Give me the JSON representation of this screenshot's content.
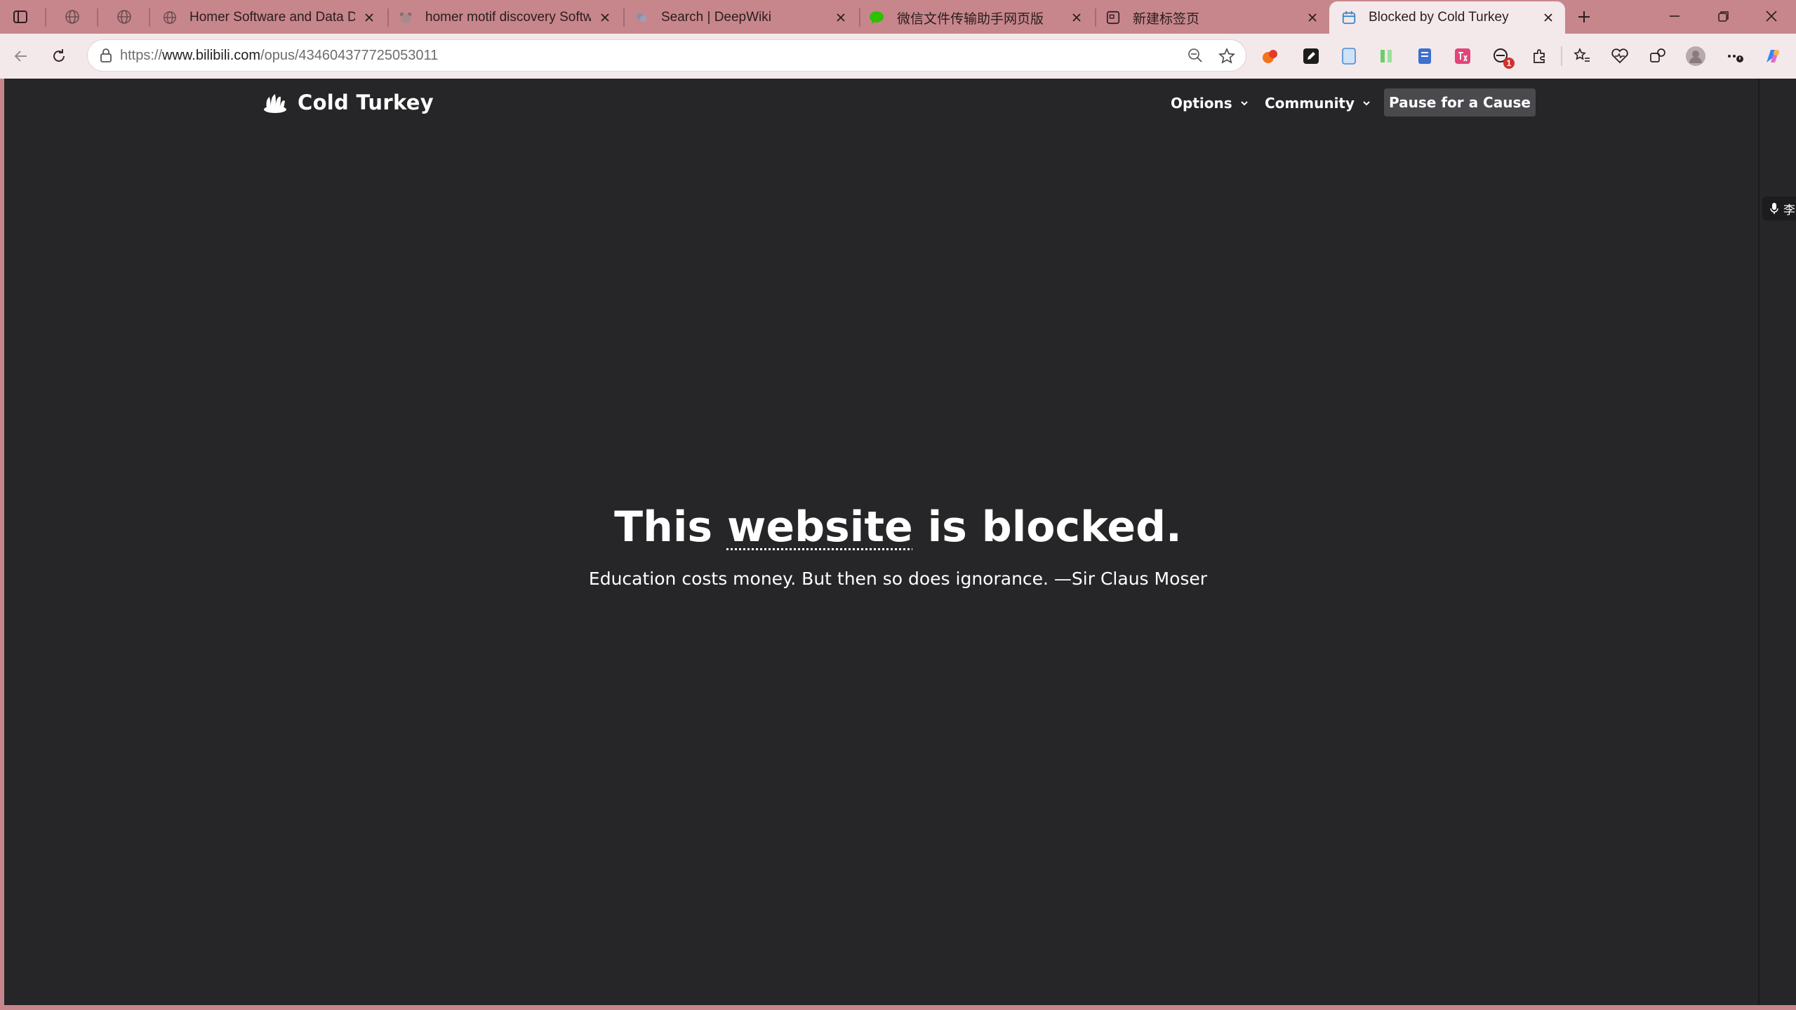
{
  "browser": {
    "tabs": [
      {
        "title": "Homer Software and Data Download",
        "favicon": "globe-icon"
      },
      {
        "title": "homer motif discovery Software",
        "favicon": "bear-icon"
      },
      {
        "title": "Search | DeepWiki",
        "favicon": "deepwiki-icon"
      },
      {
        "title": "微信文件传输助手网页版",
        "favicon": "wechat-icon"
      },
      {
        "title": "新建标签页",
        "favicon": "newtab-icon"
      },
      {
        "title": "Blocked by Cold Turkey",
        "favicon": "calendar-icon",
        "active": true
      }
    ],
    "address": {
      "scheme": "https://",
      "host": "www.bilibili.com",
      "path": "/opus/434604377725053011"
    },
    "extension_badge": "1",
    "side_badge_text": "李"
  },
  "page": {
    "brand": "Cold Turkey",
    "nav": {
      "options_label": "Options",
      "community_label": "Community",
      "pause_label": "Pause for a Cause"
    },
    "headline_before": "This",
    "headline_word": "website",
    "headline_after": "is blocked.",
    "quote": "Education costs money. But then so does ignorance. —Sir Claus Moser"
  },
  "colors": {
    "frame": "#c7868b",
    "toolbar": "#f4e9ea",
    "page_bg": "#262628",
    "button_bg": "#4a4a4e"
  }
}
